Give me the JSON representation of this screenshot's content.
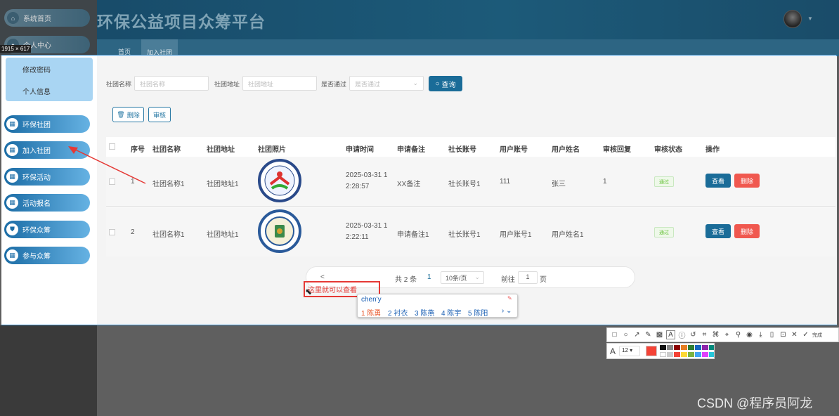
{
  "app_title": "环保公益项目众筹平台",
  "size_badge": "1915 × 617",
  "side_top": [
    "系统首页",
    "个人中心"
  ],
  "submenu": [
    "修改密码",
    "个人信息"
  ],
  "nav": [
    "环保社团",
    "加入社团",
    "环保活动",
    "活动报名",
    "环保众筹",
    "参与众筹"
  ],
  "tabs": [
    "首页",
    "加入社团"
  ],
  "search": {
    "name_label": "社团名称",
    "name_placeholder": "社团名称",
    "addr_label": "社团地址",
    "addr_placeholder": "社团地址",
    "pass_label": "是否通过",
    "pass_placeholder": "是否通过",
    "query_label": "查询"
  },
  "actions": {
    "delete_label": "删除",
    "audit_label": "审核"
  },
  "columns": [
    "序号",
    "社团名称",
    "社团地址",
    "社团照片",
    "申请时间",
    "申请备注",
    "社长账号",
    "用户账号",
    "用户姓名",
    "审核回复",
    "审核状态",
    "操作"
  ],
  "rows": [
    {
      "no": "1",
      "name": "社团名称1",
      "addr": "社团地址1",
      "time1": "2025-03-31 1",
      "time2": "2:28:57",
      "remark": "XX备注",
      "leader": "社长账号1",
      "user": "111",
      "uname": "张三",
      "reply": "1",
      "status": "通过",
      "view": "查看",
      "del": "删除"
    },
    {
      "no": "2",
      "name": "社团名称1",
      "addr": "社团地址1",
      "time1": "2025-03-31 1",
      "time2": "2:22:11",
      "remark": "申请备注1",
      "leader": "社长账号1",
      "user": "用户账号1",
      "uname": "用户姓名1",
      "reply": "",
      "status": "通过",
      "view": "查看",
      "del": "删除"
    }
  ],
  "pager": {
    "prev": "<",
    "total": "共 2 条",
    "page": "1",
    "size": "10条/页",
    "goto": "前往",
    "goto_val": "1",
    "page_unit": "页"
  },
  "note": "这里就可以查看",
  "ime": {
    "input": "chen'y",
    "cands": [
      "1 陈勇",
      "2 衬衣",
      "3 陈燕",
      "4 陈宇",
      "5 陈阳"
    ]
  },
  "toolbar_done": "完成",
  "font_size": "12",
  "watermark": "CSDN @程序员阿龙",
  "accent": "#1a6c98"
}
